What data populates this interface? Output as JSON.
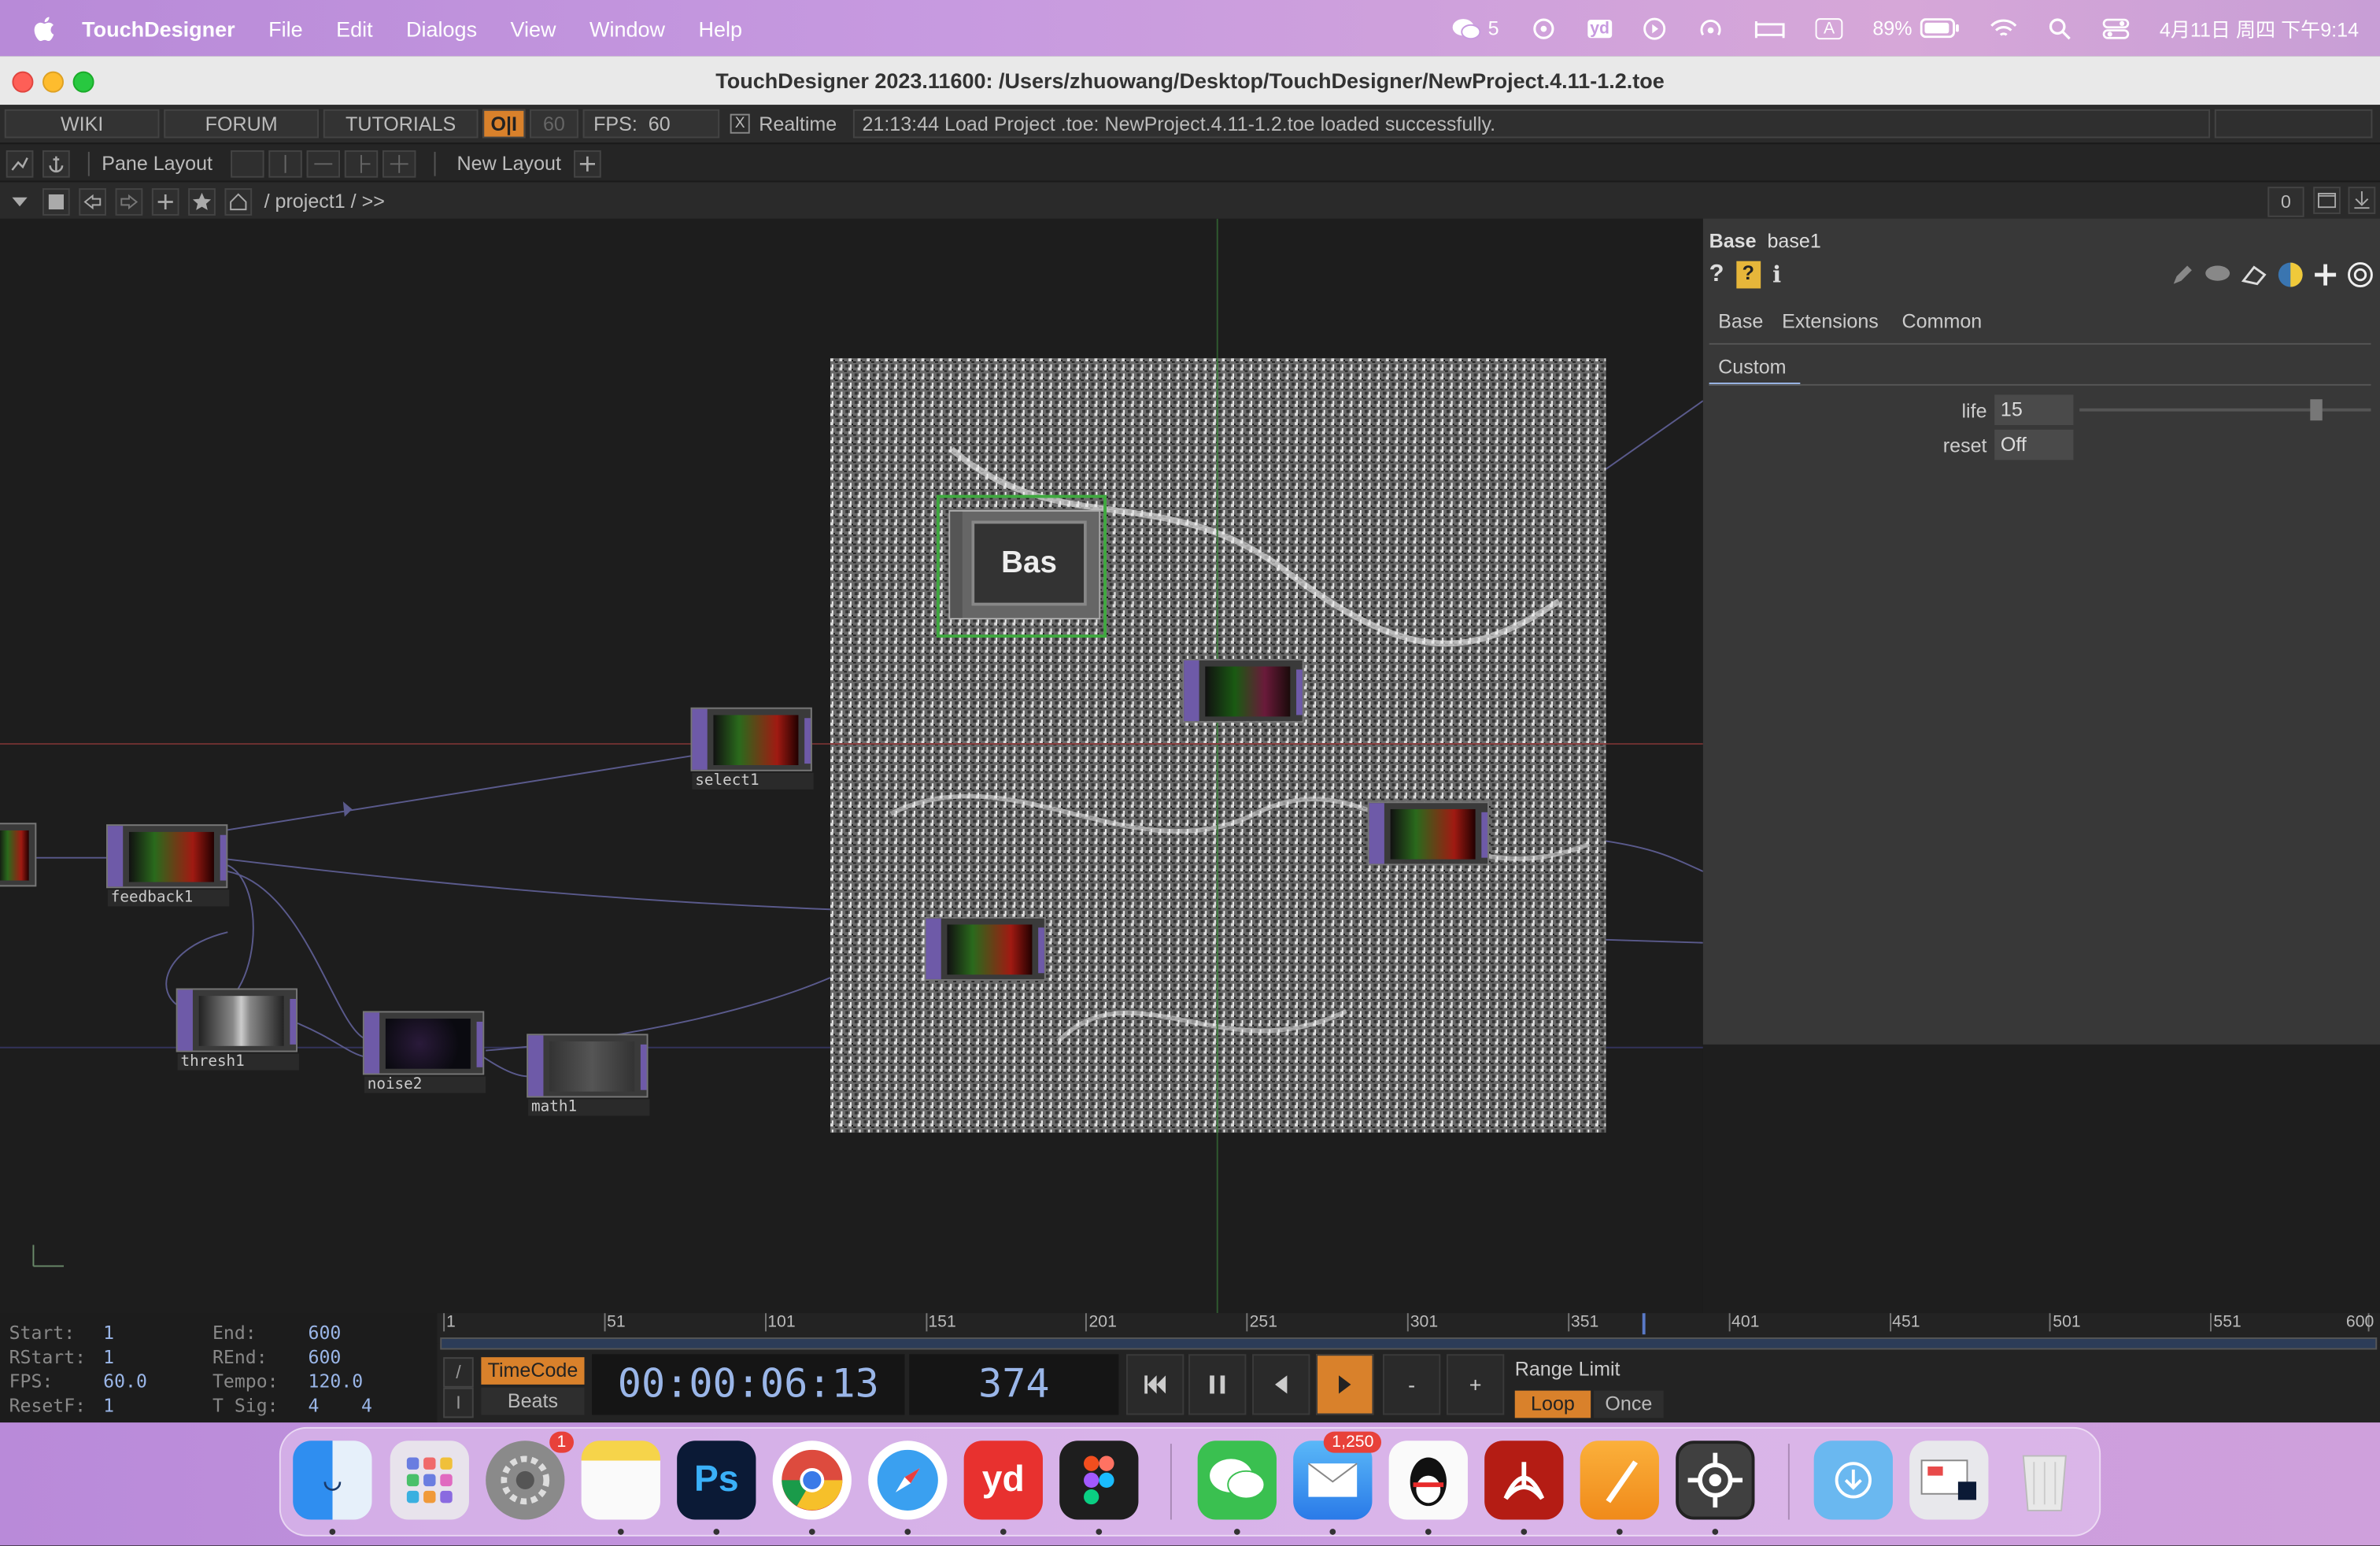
{
  "menubar": {
    "app_name": "TouchDesigner",
    "items": [
      "File",
      "Edit",
      "Dialogs",
      "View",
      "Window",
      "Help"
    ],
    "status": {
      "wechat_count": "5",
      "battery": "89%",
      "datetime": "4月11日 周四 下午9:14",
      "input_mode": "A",
      "yd": "yd"
    }
  },
  "window": {
    "title": "TouchDesigner 2023.11600: /Users/zhuowang/Desktop/TouchDesigner/NewProject.4.11-1.2.toe"
  },
  "toolbar": {
    "wiki": "WIKI",
    "forum": "FORUM",
    "tutorials": "TUTORIALS",
    "oi": "O|I",
    "fps_cap": "60",
    "fps_label": "FPS:",
    "fps_value": "60",
    "realtime_check": "X",
    "realtime": "Realtime",
    "message": "21:13:44 Load Project .toe: NewProject.4.11-1.2.toe loaded successfully.",
    "pane_layout": "Pane Layout",
    "new_layout": "New Layout",
    "path": "/ project1 / >>",
    "path_count": "0"
  },
  "network": {
    "base_label": "Bas",
    "nodes": [
      {
        "name": "select1"
      },
      {
        "name": "feedback1"
      },
      {
        "name": "thresh1"
      },
      {
        "name": "noise2"
      },
      {
        "name": "math1"
      }
    ]
  },
  "params": {
    "type": "Base",
    "name": "base1",
    "tabs": [
      "Base",
      "Extensions",
      "Common"
    ],
    "subtab": "Custom",
    "life_label": "life",
    "life_value": "15",
    "reset_label": "reset",
    "reset_value": "Off",
    "life_slider_fraction": 0.81
  },
  "timeline": {
    "info": {
      "start_label": "Start:",
      "start": "1",
      "end_label": "End:",
      "end": "600",
      "rstart_label": "RStart:",
      "rstart": "1",
      "rend_label": "REnd:",
      "rend": "600",
      "fps_label": "FPS:",
      "fps": "60.0",
      "tempo_label": "Tempo:",
      "tempo": "120.0",
      "resetf_label": "ResetF:",
      "resetf": "1",
      "tsig_label": "T Sig:",
      "tsig_a": "4",
      "tsig_b": "4"
    },
    "ruler_ticks": [
      "1",
      "51",
      "101",
      "151",
      "201",
      "251",
      "301",
      "351",
      "401",
      "451",
      "501",
      "551",
      "600"
    ],
    "playhead_frame": 374,
    "slash": "/",
    "i_label": "I",
    "timecode_btn": "TimeCode",
    "beats_btn": "Beats",
    "timecode": "00:00:06:13",
    "frame": "374",
    "range_limit": "Range Limit",
    "loop": "Loop",
    "once": "Once",
    "minus": "-",
    "plus": "+"
  },
  "dock": {
    "settings_badge": "1",
    "mail_badge": "1,250",
    "ps_label": "Ps",
    "yd_label": "yd"
  }
}
